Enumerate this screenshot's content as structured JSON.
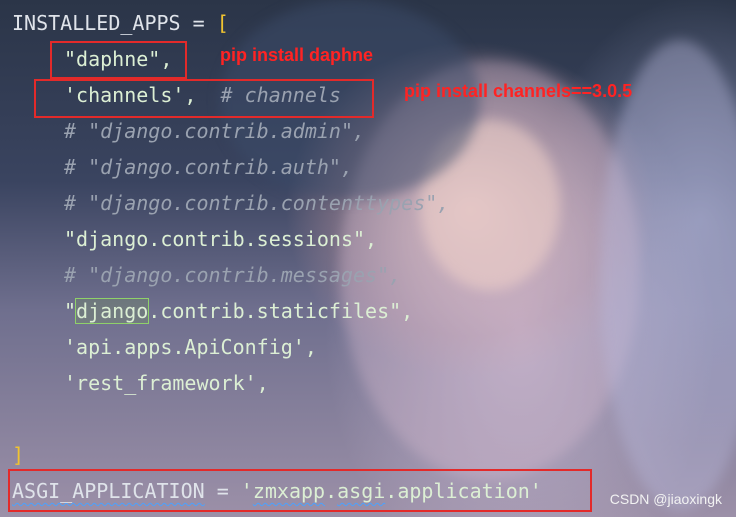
{
  "code": {
    "line1": {
      "name": "INSTALLED_APPS",
      "eq": " = ",
      "bracket": "["
    },
    "line2": "\"daphne\",",
    "line3": {
      "str": "'channels',",
      "comment": "# channels"
    },
    "line4": "# \"django.contrib.admin\",",
    "line5": "# \"django.contrib.auth\",",
    "line6": "# \"django.contrib.contenttypes\",",
    "line7": "\"django.contrib.sessions\",",
    "line8": "# \"django.contrib.messages\",",
    "line9": {
      "q": "\"",
      "hl": "django",
      "rest": ".contrib.staticfiles\","
    },
    "line10": "'api.apps.ApiConfig',",
    "line11": "'rest_framework',",
    "line12": "]",
    "line13": {
      "name": "ASGI_APPLICATION",
      "eq": " = ",
      "q1": "'",
      "p1": "zmxapp",
      "dot1": ".",
      "p2": "asgi",
      "rest": ".application'"
    }
  },
  "annotations": {
    "daphne": "pip install daphne",
    "channels": "pip install channels==3.0.5"
  },
  "watermark": "CSDN @jiaoxingk",
  "colors": {
    "annotation_red": "#e32a2a",
    "string_text": "#dcefd4",
    "comment_text": "#9aa2b0",
    "bracket": "#f0c330"
  }
}
